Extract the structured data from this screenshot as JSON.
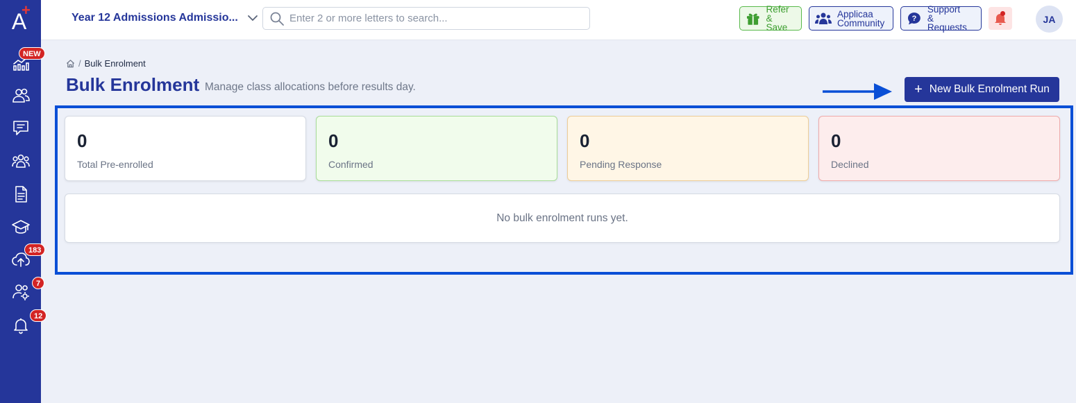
{
  "sidebar": {
    "logo_letter": "A",
    "logo_plus": "+",
    "items": [
      {
        "icon": "analytics-icon",
        "badge": "NEW"
      },
      {
        "icon": "people-icon",
        "badge": ""
      },
      {
        "icon": "messages-icon",
        "badge": ""
      },
      {
        "icon": "group-icon",
        "badge": ""
      },
      {
        "icon": "document-icon",
        "badge": ""
      },
      {
        "icon": "graduation-cap-icon",
        "badge": ""
      },
      {
        "icon": "cloud-upload-icon",
        "badge": "183"
      },
      {
        "icon": "user-settings-icon",
        "badge": "7"
      },
      {
        "icon": "bell-icon",
        "badge": "12"
      }
    ]
  },
  "topbar": {
    "context_title": "Year 12 Admissions Admissio...",
    "search_placeholder": "Enter 2 or more letters to search...",
    "refer_line1": "Refer",
    "refer_line2": "& Save",
    "community_line1": "Applicaa",
    "community_line2": "Community",
    "support_line1": "Support",
    "support_line2": "& Requests",
    "avatar_initials": "JA"
  },
  "breadcrumb": {
    "separator": "/",
    "current": "Bulk Enrolment"
  },
  "page": {
    "title": "Bulk Enrolment",
    "subtitle": "Manage class allocations before results day.",
    "new_button_icon": "+",
    "new_button_label": "New Bulk Enrolment Run"
  },
  "stats": {
    "total": {
      "value": "0",
      "label": "Total Pre-enrolled"
    },
    "confirmed": {
      "value": "0",
      "label": "Confirmed"
    },
    "pending": {
      "value": "0",
      "label": "Pending Response"
    },
    "declined": {
      "value": "0",
      "label": "Declined"
    }
  },
  "empty_state": "No bulk enrolment runs yet.",
  "colors": {
    "brand": "#25369a",
    "sidebar": "#25369a",
    "badge": "#d32424",
    "highlight": "#0a4fd6"
  }
}
